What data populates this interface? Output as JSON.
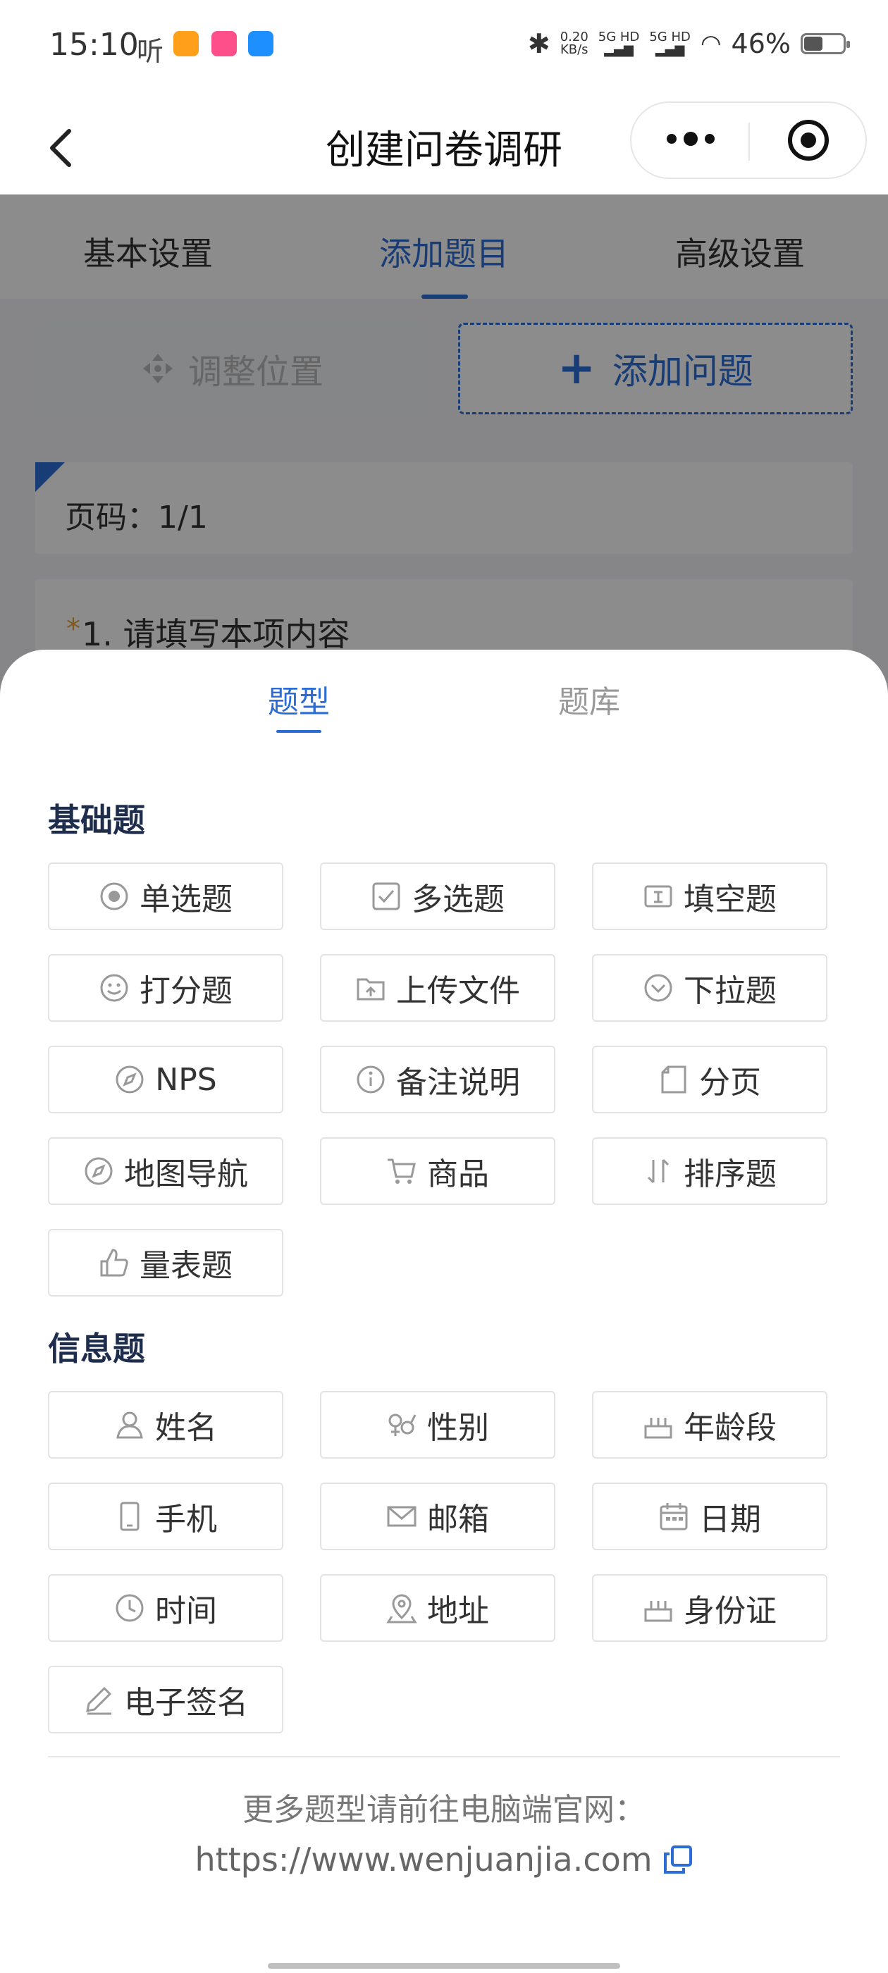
{
  "status_bar": {
    "time": "15:10",
    "network_speed": "0.20",
    "network_unit": "KB/s",
    "sim1": "5G HD",
    "sim2": "5G HD",
    "battery": "46%"
  },
  "nav": {
    "title": "创建问卷调研"
  },
  "main_tabs": [
    {
      "label": "基本设置"
    },
    {
      "label": "添加题目"
    },
    {
      "label": "高级设置"
    }
  ],
  "actions": {
    "adjust_label": "调整位置",
    "add_label": "添加问题"
  },
  "page_card": {
    "text": "页码：1/1"
  },
  "question_card": {
    "required_mark": "*",
    "text": "1.   请填写本项内容"
  },
  "sheet": {
    "tabs": [
      {
        "label": "题型"
      },
      {
        "label": "题库"
      }
    ],
    "basic_title": "基础题",
    "basic_items": [
      {
        "label": "单选题",
        "icon": "radio-icon"
      },
      {
        "label": "多选题",
        "icon": "checkbox-icon"
      },
      {
        "label": "填空题",
        "icon": "text-input-icon"
      },
      {
        "label": "打分题",
        "icon": "smile-icon"
      },
      {
        "label": "上传文件",
        "icon": "upload-folder-icon"
      },
      {
        "label": "下拉题",
        "icon": "dropdown-icon"
      },
      {
        "label": "NPS",
        "icon": "compass-icon"
      },
      {
        "label": "备注说明",
        "icon": "info-icon"
      },
      {
        "label": "分页",
        "icon": "page-icon"
      },
      {
        "label": "地图导航",
        "icon": "compass-icon"
      },
      {
        "label": "商品",
        "icon": "cart-icon"
      },
      {
        "label": "排序题",
        "icon": "sort-icon"
      },
      {
        "label": "量表题",
        "icon": "thumbs-up-icon"
      }
    ],
    "info_title": "信息题",
    "info_items": [
      {
        "label": "姓名",
        "icon": "user-icon"
      },
      {
        "label": "性别",
        "icon": "gender-icon"
      },
      {
        "label": "年龄段",
        "icon": "cake-icon"
      },
      {
        "label": "手机",
        "icon": "phone-icon"
      },
      {
        "label": "邮箱",
        "icon": "mail-icon"
      },
      {
        "label": "日期",
        "icon": "calendar-icon"
      },
      {
        "label": "时间",
        "icon": "clock-icon"
      },
      {
        "label": "地址",
        "icon": "location-icon"
      },
      {
        "label": "身份证",
        "icon": "cake-icon"
      },
      {
        "label": "电子签名",
        "icon": "pen-icon"
      }
    ],
    "more_text": "更多题型请前往电脑端官网：",
    "link": "https://www.wenjuanjia.com"
  },
  "colors": {
    "accent": "#2c6dd5",
    "section_title": "#1f2d4d",
    "overlay": "rgba(0,0,0,0.45)"
  }
}
